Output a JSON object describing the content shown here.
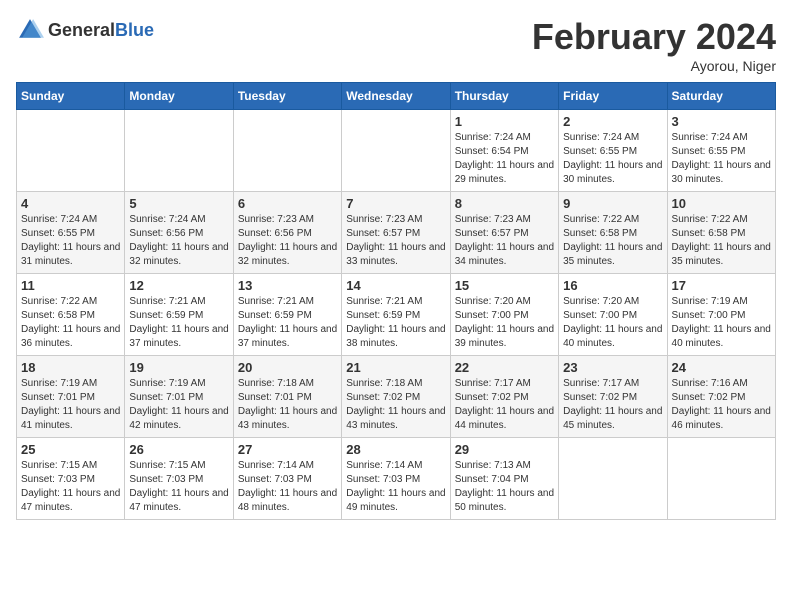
{
  "header": {
    "logo_general": "General",
    "logo_blue": "Blue",
    "title": "February 2024",
    "location": "Ayorou, Niger"
  },
  "days_of_week": [
    "Sunday",
    "Monday",
    "Tuesday",
    "Wednesday",
    "Thursday",
    "Friday",
    "Saturday"
  ],
  "weeks": [
    [
      {
        "day": "",
        "sunrise": "",
        "sunset": "",
        "daylight": ""
      },
      {
        "day": "",
        "sunrise": "",
        "sunset": "",
        "daylight": ""
      },
      {
        "day": "",
        "sunrise": "",
        "sunset": "",
        "daylight": ""
      },
      {
        "day": "",
        "sunrise": "",
        "sunset": "",
        "daylight": ""
      },
      {
        "day": "1",
        "sunrise": "Sunrise: 7:24 AM",
        "sunset": "Sunset: 6:54 PM",
        "daylight": "Daylight: 11 hours and 29 minutes."
      },
      {
        "day": "2",
        "sunrise": "Sunrise: 7:24 AM",
        "sunset": "Sunset: 6:55 PM",
        "daylight": "Daylight: 11 hours and 30 minutes."
      },
      {
        "day": "3",
        "sunrise": "Sunrise: 7:24 AM",
        "sunset": "Sunset: 6:55 PM",
        "daylight": "Daylight: 11 hours and 30 minutes."
      }
    ],
    [
      {
        "day": "4",
        "sunrise": "Sunrise: 7:24 AM",
        "sunset": "Sunset: 6:55 PM",
        "daylight": "Daylight: 11 hours and 31 minutes."
      },
      {
        "day": "5",
        "sunrise": "Sunrise: 7:24 AM",
        "sunset": "Sunset: 6:56 PM",
        "daylight": "Daylight: 11 hours and 32 minutes."
      },
      {
        "day": "6",
        "sunrise": "Sunrise: 7:23 AM",
        "sunset": "Sunset: 6:56 PM",
        "daylight": "Daylight: 11 hours and 32 minutes."
      },
      {
        "day": "7",
        "sunrise": "Sunrise: 7:23 AM",
        "sunset": "Sunset: 6:57 PM",
        "daylight": "Daylight: 11 hours and 33 minutes."
      },
      {
        "day": "8",
        "sunrise": "Sunrise: 7:23 AM",
        "sunset": "Sunset: 6:57 PM",
        "daylight": "Daylight: 11 hours and 34 minutes."
      },
      {
        "day": "9",
        "sunrise": "Sunrise: 7:22 AM",
        "sunset": "Sunset: 6:58 PM",
        "daylight": "Daylight: 11 hours and 35 minutes."
      },
      {
        "day": "10",
        "sunrise": "Sunrise: 7:22 AM",
        "sunset": "Sunset: 6:58 PM",
        "daylight": "Daylight: 11 hours and 35 minutes."
      }
    ],
    [
      {
        "day": "11",
        "sunrise": "Sunrise: 7:22 AM",
        "sunset": "Sunset: 6:58 PM",
        "daylight": "Daylight: 11 hours and 36 minutes."
      },
      {
        "day": "12",
        "sunrise": "Sunrise: 7:21 AM",
        "sunset": "Sunset: 6:59 PM",
        "daylight": "Daylight: 11 hours and 37 minutes."
      },
      {
        "day": "13",
        "sunrise": "Sunrise: 7:21 AM",
        "sunset": "Sunset: 6:59 PM",
        "daylight": "Daylight: 11 hours and 37 minutes."
      },
      {
        "day": "14",
        "sunrise": "Sunrise: 7:21 AM",
        "sunset": "Sunset: 6:59 PM",
        "daylight": "Daylight: 11 hours and 38 minutes."
      },
      {
        "day": "15",
        "sunrise": "Sunrise: 7:20 AM",
        "sunset": "Sunset: 7:00 PM",
        "daylight": "Daylight: 11 hours and 39 minutes."
      },
      {
        "day": "16",
        "sunrise": "Sunrise: 7:20 AM",
        "sunset": "Sunset: 7:00 PM",
        "daylight": "Daylight: 11 hours and 40 minutes."
      },
      {
        "day": "17",
        "sunrise": "Sunrise: 7:19 AM",
        "sunset": "Sunset: 7:00 PM",
        "daylight": "Daylight: 11 hours and 40 minutes."
      }
    ],
    [
      {
        "day": "18",
        "sunrise": "Sunrise: 7:19 AM",
        "sunset": "Sunset: 7:01 PM",
        "daylight": "Daylight: 11 hours and 41 minutes."
      },
      {
        "day": "19",
        "sunrise": "Sunrise: 7:19 AM",
        "sunset": "Sunset: 7:01 PM",
        "daylight": "Daylight: 11 hours and 42 minutes."
      },
      {
        "day": "20",
        "sunrise": "Sunrise: 7:18 AM",
        "sunset": "Sunset: 7:01 PM",
        "daylight": "Daylight: 11 hours and 43 minutes."
      },
      {
        "day": "21",
        "sunrise": "Sunrise: 7:18 AM",
        "sunset": "Sunset: 7:02 PM",
        "daylight": "Daylight: 11 hours and 43 minutes."
      },
      {
        "day": "22",
        "sunrise": "Sunrise: 7:17 AM",
        "sunset": "Sunset: 7:02 PM",
        "daylight": "Daylight: 11 hours and 44 minutes."
      },
      {
        "day": "23",
        "sunrise": "Sunrise: 7:17 AM",
        "sunset": "Sunset: 7:02 PM",
        "daylight": "Daylight: 11 hours and 45 minutes."
      },
      {
        "day": "24",
        "sunrise": "Sunrise: 7:16 AM",
        "sunset": "Sunset: 7:02 PM",
        "daylight": "Daylight: 11 hours and 46 minutes."
      }
    ],
    [
      {
        "day": "25",
        "sunrise": "Sunrise: 7:15 AM",
        "sunset": "Sunset: 7:03 PM",
        "daylight": "Daylight: 11 hours and 47 minutes."
      },
      {
        "day": "26",
        "sunrise": "Sunrise: 7:15 AM",
        "sunset": "Sunset: 7:03 PM",
        "daylight": "Daylight: 11 hours and 47 minutes."
      },
      {
        "day": "27",
        "sunrise": "Sunrise: 7:14 AM",
        "sunset": "Sunset: 7:03 PM",
        "daylight": "Daylight: 11 hours and 48 minutes."
      },
      {
        "day": "28",
        "sunrise": "Sunrise: 7:14 AM",
        "sunset": "Sunset: 7:03 PM",
        "daylight": "Daylight: 11 hours and 49 minutes."
      },
      {
        "day": "29",
        "sunrise": "Sunrise: 7:13 AM",
        "sunset": "Sunset: 7:04 PM",
        "daylight": "Daylight: 11 hours and 50 minutes."
      },
      {
        "day": "",
        "sunrise": "",
        "sunset": "",
        "daylight": ""
      },
      {
        "day": "",
        "sunrise": "",
        "sunset": "",
        "daylight": ""
      }
    ]
  ]
}
